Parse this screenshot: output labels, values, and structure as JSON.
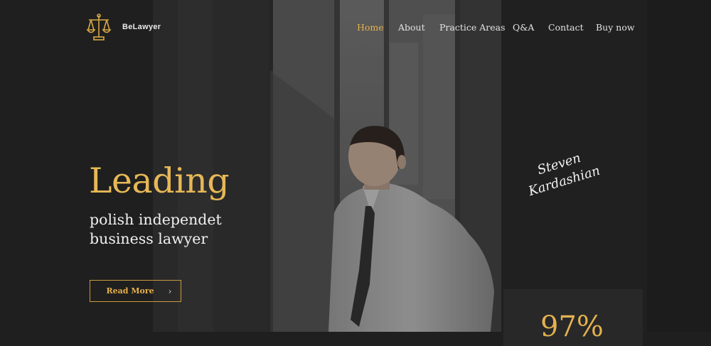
{
  "brand": {
    "name": "BeLawyer",
    "logo_icon": "scales-of-justice-icon",
    "accent": "#e4b04a"
  },
  "nav": {
    "items": [
      {
        "label": "Home",
        "active": true
      },
      {
        "label": "About",
        "active": false
      },
      {
        "label": "Practice Areas",
        "active": false
      },
      {
        "label": "Q&A",
        "active": false
      },
      {
        "label": "Contact",
        "active": false
      },
      {
        "label": "Buy now",
        "active": false
      }
    ]
  },
  "hero": {
    "headline": "Leading",
    "subtitle_line1": "polish independet",
    "subtitle_line2": "business lawyer",
    "cta_label": "Read More",
    "cta_icon": "chevron-right-icon",
    "signature_line1": "Steven",
    "signature_line2": "Kardashian"
  },
  "stat": {
    "value": "97%"
  }
}
